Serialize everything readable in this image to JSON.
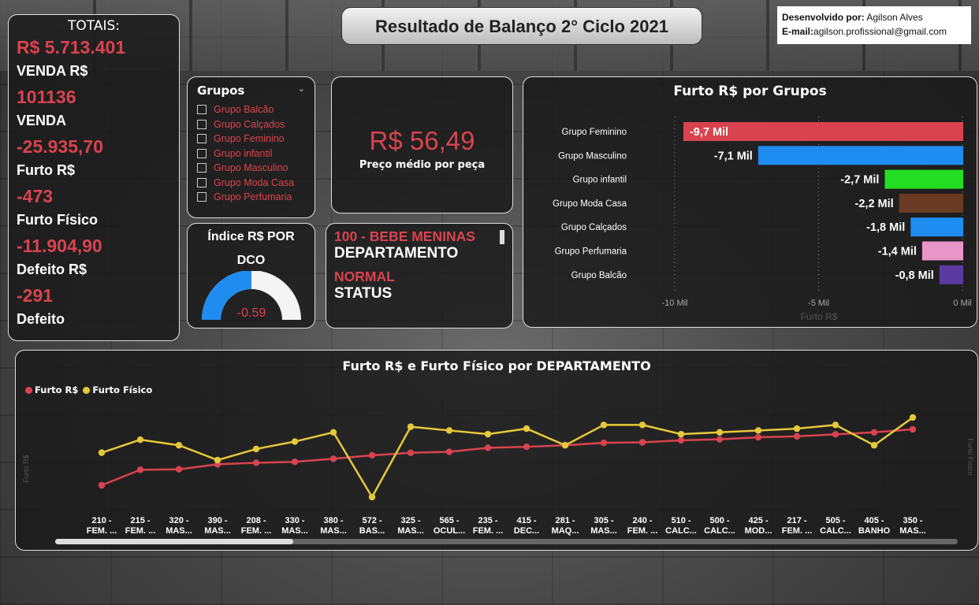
{
  "title": "Resultado de Balanço 2° Ciclo 2021",
  "developer": {
    "label": "Desenvolvido por:",
    "name": "Agilson Alves",
    "email_label": "E-mail:",
    "email": "agilson.profissional@gmail.com"
  },
  "totals": {
    "header": "TOTAIS:",
    "items": [
      {
        "value": "R$ 5.713.401",
        "label": "VENDA R$"
      },
      {
        "value": "101136",
        "label": "VENDA"
      },
      {
        "value": "-25.935,70",
        "label": "Furto R$"
      },
      {
        "value": "-473",
        "label": "Furto Físico"
      },
      {
        "value": "-11.904,90",
        "label": "Defeito R$"
      },
      {
        "value": "-291",
        "label": "Defeito"
      }
    ]
  },
  "grupos": {
    "title": "Grupos",
    "items": [
      "Grupo Balcão",
      "Grupo Calçados",
      "Grupo Feminino",
      "Grupo infantil",
      "Grupo Masculino",
      "Grupo Moda Casa",
      "Grupo Perfumaria"
    ]
  },
  "preco": {
    "value": "R$ 56,49",
    "label": "Preço médio por peça"
  },
  "indice": {
    "title_line1": "Índice R$ POR",
    "title_line2": "DCO",
    "value": "-0.59",
    "fill_fraction": 0.5
  },
  "departamento": {
    "value": "100 - BEBE MENINAS",
    "label": "DEPARTAMENTO",
    "status_value": "NORMAL",
    "status_label": "STATUS"
  },
  "colors": {
    "red": "#d9434f",
    "yellow": "#e6c93a"
  },
  "chart_data": [
    {
      "type": "bar",
      "title": "Furto R$ por Grupos",
      "xlabel": "Furto R$",
      "categories": [
        "Grupo Feminino",
        "Grupo Masculino",
        "Grupo infantil",
        "Grupo Moda Casa",
        "Grupo Calçados",
        "Grupo Perfumaria",
        "Grupo Balcão"
      ],
      "values": [
        -9.7,
        -7.1,
        -2.7,
        -2.2,
        -1.8,
        -1.4,
        -0.8
      ],
      "data_labels": [
        "-9,7 Mil",
        "-7,1 Mil",
        "-2,7 Mil",
        "-2,2 Mil",
        "-1,8 Mil",
        "-1,4 Mil",
        "-0,8 Mil"
      ],
      "colors": [
        "#d9434f",
        "#1e8cf0",
        "#22dd22",
        "#6b3a22",
        "#1e8cf0",
        "#e896c8",
        "#5a3aa0"
      ],
      "xlim": [
        -10,
        0
      ],
      "xticks": [
        "-10 Mil",
        "-5 Mil",
        "0 Mil"
      ]
    },
    {
      "type": "line",
      "title": "Furto R$ e Furto Físico por DEPARTAMENTO",
      "categories": [
        [
          "210 -",
          "FEM. ..."
        ],
        [
          "215 -",
          "FEM. ..."
        ],
        [
          "320 -",
          "MAS..."
        ],
        [
          "390 -",
          "MAS..."
        ],
        [
          "208 -",
          "FEM. ..."
        ],
        [
          "330 -",
          "MAS..."
        ],
        [
          "380 -",
          "MAS..."
        ],
        [
          "572 -",
          "BAS..."
        ],
        [
          "325 -",
          "MAS..."
        ],
        [
          "565 -",
          "OCUL..."
        ],
        [
          "235 -",
          "FEM. ..."
        ],
        [
          "415 -",
          "DEC..."
        ],
        [
          "281 -",
          "MAQ..."
        ],
        [
          "305 -",
          "MAS..."
        ],
        [
          "240 -",
          "FEM. ..."
        ],
        [
          "510 -",
          "CALC..."
        ],
        [
          "500 -",
          "CALC..."
        ],
        [
          "425 -",
          "MOD..."
        ],
        [
          "217 -",
          "FEM. ..."
        ],
        [
          "505 -",
          "CALC..."
        ],
        [
          "405 -",
          "BANHO"
        ],
        [
          "350 -",
          "MAS..."
        ]
      ],
      "series": [
        {
          "name": "Furto R$",
          "color": "#d9434f",
          "values": [
            -2800,
            -1250,
            -1200,
            -700,
            -550,
            -450,
            -150,
            200,
            450,
            550,
            950,
            1050,
            1200,
            1450,
            1500,
            1700,
            1800,
            2000,
            2100,
            2300,
            2500,
            2800
          ]
        },
        {
          "name": "Furto Físico",
          "color": "#e6c93a",
          "values": [
            -9,
            -2,
            -5,
            -13,
            -7,
            -3,
            2,
            -33,
            5,
            3,
            1,
            4,
            -5,
            6,
            6,
            1,
            2,
            3,
            4,
            6,
            -5,
            10
          ]
        }
      ],
      "ylabel_left": "Furto R$",
      "ylabel_right": "Furto Físico"
    }
  ]
}
